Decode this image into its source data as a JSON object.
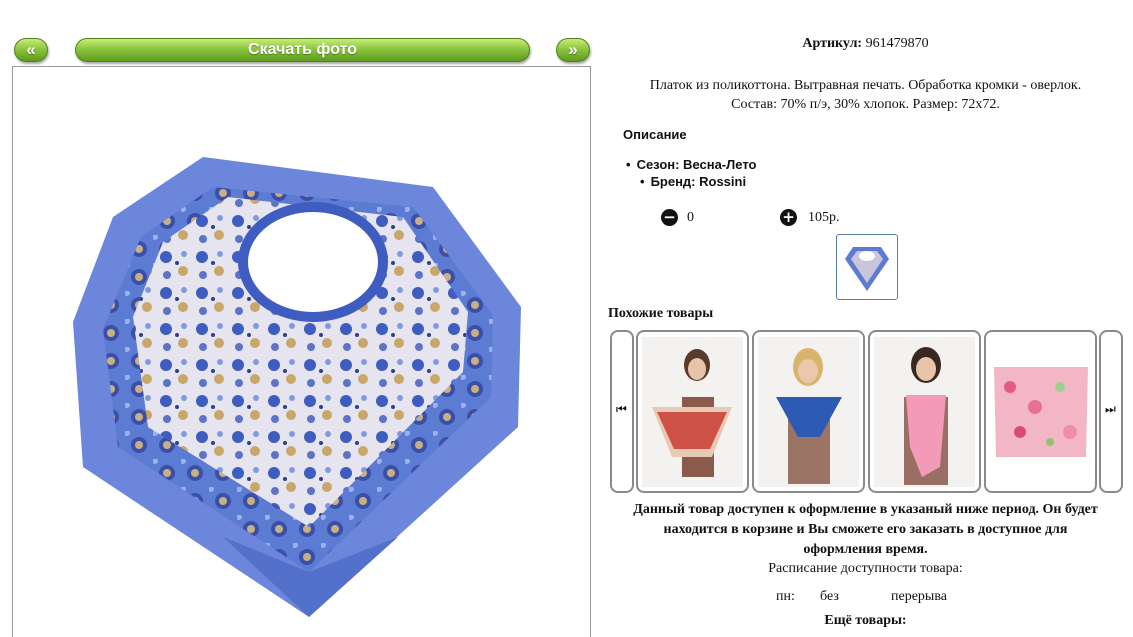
{
  "nav": {
    "prev_label": "«",
    "download_label": "Скачать фото",
    "next_label": "»"
  },
  "product": {
    "article_label": "Артикул:",
    "article_value": "961479870",
    "description_line1": "Платок из поликоттона. Вытравная печать. Обработка кромки - оверлок.",
    "description_line2": "Состав: 70% п/э, 30% хлопок. Размер: 72х72.",
    "description_heading": "Описание",
    "attributes": [
      "Сезон: Весна-Лето",
      "Бренд: Rossini"
    ],
    "quantity": "0",
    "price": "105р."
  },
  "similar": {
    "heading": "Похожие товары"
  },
  "availability": {
    "notice_line1": "Данный товар доступен к оформление в указаный ниже период. Он будет",
    "notice_line2": "находится в корзине и Вы сможете его заказать в доступное для",
    "notice_line3": "оформления время.",
    "schedule_label": "Расписание доступности товара:",
    "day": "пн:",
    "bez": "без",
    "break_word": "перерыва"
  },
  "more": {
    "heading": "Ещё товары:"
  },
  "colors": {
    "nav_green": "#8cc63f",
    "scarf_blue": "#5a78d2",
    "link_green": "#1a8a1a"
  }
}
